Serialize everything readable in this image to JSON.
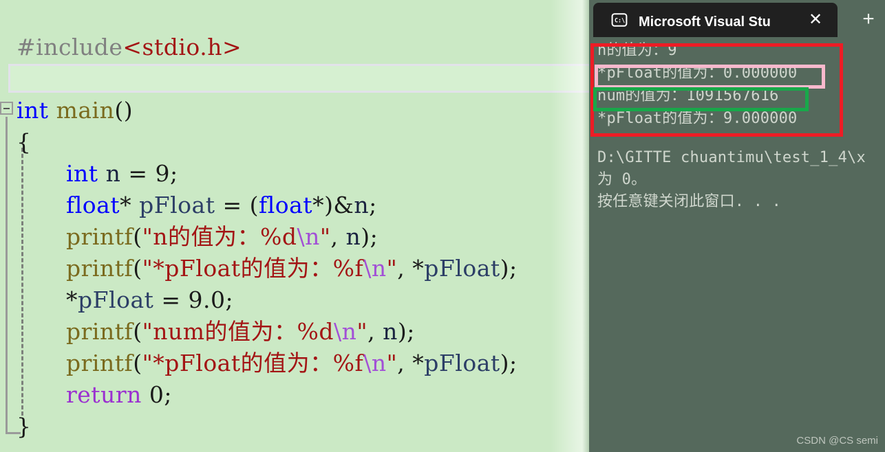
{
  "editor": {
    "name": "code-editor",
    "background": "#cbe9c5",
    "fold_marker": "collapse-minus",
    "code_lines": [
      {
        "indent": 1,
        "tokens": [
          {
            "t": "#include",
            "c": "k-pre"
          },
          {
            "t": "<stdio.h>",
            "c": "k-hdr"
          }
        ]
      },
      {
        "indent": 1,
        "tokens": []
      },
      {
        "indent": 1,
        "tokens": [
          {
            "t": "int",
            "c": "k-type"
          },
          {
            "t": " ",
            "c": "k-pun"
          },
          {
            "t": "main",
            "c": "k-fn"
          },
          {
            "t": "()",
            "c": "k-pun"
          }
        ]
      },
      {
        "indent": 1,
        "tokens": [
          {
            "t": "{",
            "c": "k-brace"
          }
        ]
      },
      {
        "indent": 3,
        "tokens": [
          {
            "t": "int",
            "c": "k-type"
          },
          {
            "t": " ",
            "c": "k-pun"
          },
          {
            "t": "n",
            "c": "k-var"
          },
          {
            "t": " = ",
            "c": "k-pun"
          },
          {
            "t": "9",
            "c": "k-num"
          },
          {
            "t": ";",
            "c": "k-pun"
          }
        ]
      },
      {
        "indent": 3,
        "tokens": [
          {
            "t": "float",
            "c": "k-type"
          },
          {
            "t": "*",
            "c": "k-pun"
          },
          {
            "t": " ",
            "c": "k-pun"
          },
          {
            "t": "pFloat",
            "c": "k-id"
          },
          {
            "t": " = ",
            "c": "k-pun"
          },
          {
            "t": "(",
            "c": "k-pun"
          },
          {
            "t": "float",
            "c": "k-type"
          },
          {
            "t": "*",
            "c": "k-pun"
          },
          {
            "t": ")&",
            "c": "k-pun"
          },
          {
            "t": "n",
            "c": "k-var"
          },
          {
            "t": ";",
            "c": "k-pun"
          }
        ]
      },
      {
        "indent": 3,
        "tokens": [
          {
            "t": "printf",
            "c": "k-fn"
          },
          {
            "t": "(",
            "c": "k-pun"
          },
          {
            "t": "\"n的值为：%d",
            "c": "k-str"
          },
          {
            "t": "\\n",
            "c": "k-esc"
          },
          {
            "t": "\"",
            "c": "k-str"
          },
          {
            "t": ", ",
            "c": "k-pun"
          },
          {
            "t": "n",
            "c": "k-var"
          },
          {
            "t": ");",
            "c": "k-pun"
          }
        ]
      },
      {
        "indent": 3,
        "tokens": [
          {
            "t": "printf",
            "c": "k-fn"
          },
          {
            "t": "(",
            "c": "k-pun"
          },
          {
            "t": "\"*pFloat的值为：%f",
            "c": "k-str"
          },
          {
            "t": "\\n",
            "c": "k-esc"
          },
          {
            "t": "\"",
            "c": "k-str"
          },
          {
            "t": ", ",
            "c": "k-pun"
          },
          {
            "t": "*",
            "c": "k-pun"
          },
          {
            "t": "pFloat",
            "c": "k-id"
          },
          {
            "t": ");",
            "c": "k-pun"
          }
        ]
      },
      {
        "indent": 3,
        "tokens": [
          {
            "t": "*",
            "c": "k-pun"
          },
          {
            "t": "pFloat",
            "c": "k-id"
          },
          {
            "t": " = ",
            "c": "k-pun"
          },
          {
            "t": "9.0",
            "c": "k-num"
          },
          {
            "t": ";",
            "c": "k-pun"
          }
        ]
      },
      {
        "indent": 3,
        "tokens": [
          {
            "t": "printf",
            "c": "k-fn"
          },
          {
            "t": "(",
            "c": "k-pun"
          },
          {
            "t": "\"num的值为：%d",
            "c": "k-str"
          },
          {
            "t": "\\n",
            "c": "k-esc"
          },
          {
            "t": "\"",
            "c": "k-str"
          },
          {
            "t": ", ",
            "c": "k-pun"
          },
          {
            "t": "n",
            "c": "k-var"
          },
          {
            "t": ");",
            "c": "k-pun"
          }
        ]
      },
      {
        "indent": 3,
        "tokens": [
          {
            "t": "printf",
            "c": "k-fn"
          },
          {
            "t": "(",
            "c": "k-pun"
          },
          {
            "t": "\"*pFloat的值为：%f",
            "c": "k-str"
          },
          {
            "t": "\\n",
            "c": "k-esc"
          },
          {
            "t": "\"",
            "c": "k-str"
          },
          {
            "t": ", ",
            "c": "k-pun"
          },
          {
            "t": "*",
            "c": "k-pun"
          },
          {
            "t": "pFloat",
            "c": "k-id"
          },
          {
            "t": ");",
            "c": "k-pun"
          }
        ]
      },
      {
        "indent": 3,
        "tokens": [
          {
            "t": "return",
            "c": "k-kw"
          },
          {
            "t": " ",
            "c": "k-pun"
          },
          {
            "t": "0",
            "c": "k-num"
          },
          {
            "t": ";",
            "c": "k-pun"
          }
        ]
      },
      {
        "indent": 1,
        "tokens": [
          {
            "t": "}",
            "c": "k-brace"
          }
        ]
      }
    ]
  },
  "console": {
    "tab": {
      "icon": "console-cmd-icon",
      "icon_text": "C:\\",
      "title": "Microsoft Visual Studio 调试控制台",
      "close_label": "✕",
      "new_tab_label": "+"
    },
    "background": "#55695c",
    "output_lines": [
      "n的值为：9",
      "*pFloat的值为：0.000000",
      "num的值为：1091567616",
      "*pFloat的值为：9.000000"
    ],
    "footer_lines": [
      "D:\\GITTE chuantimu\\test_1_4\\x",
      "为 0。",
      "按任意键关闭此窗口. . ."
    ],
    "annotations": {
      "outer_color": "#ee1c25",
      "pink_color": "#f9b9cd",
      "green_color": "#18a84a"
    }
  },
  "watermark": "CSDN @CS semi"
}
